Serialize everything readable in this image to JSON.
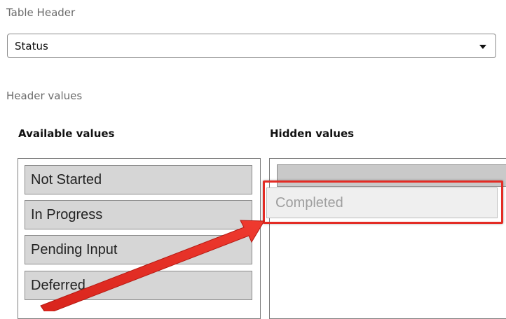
{
  "table_header": {
    "label": "Table Header",
    "selected": "Status"
  },
  "header_values": {
    "label": "Header values",
    "available": {
      "title": "Available values",
      "items": [
        "Not Started",
        "In Progress",
        "Pending Input",
        "Deferred"
      ]
    },
    "hidden": {
      "title": "Hidden values",
      "dragging_item": "Completed"
    }
  },
  "annotation": {
    "color": "#e32b24",
    "icon": "arrow-icon"
  }
}
